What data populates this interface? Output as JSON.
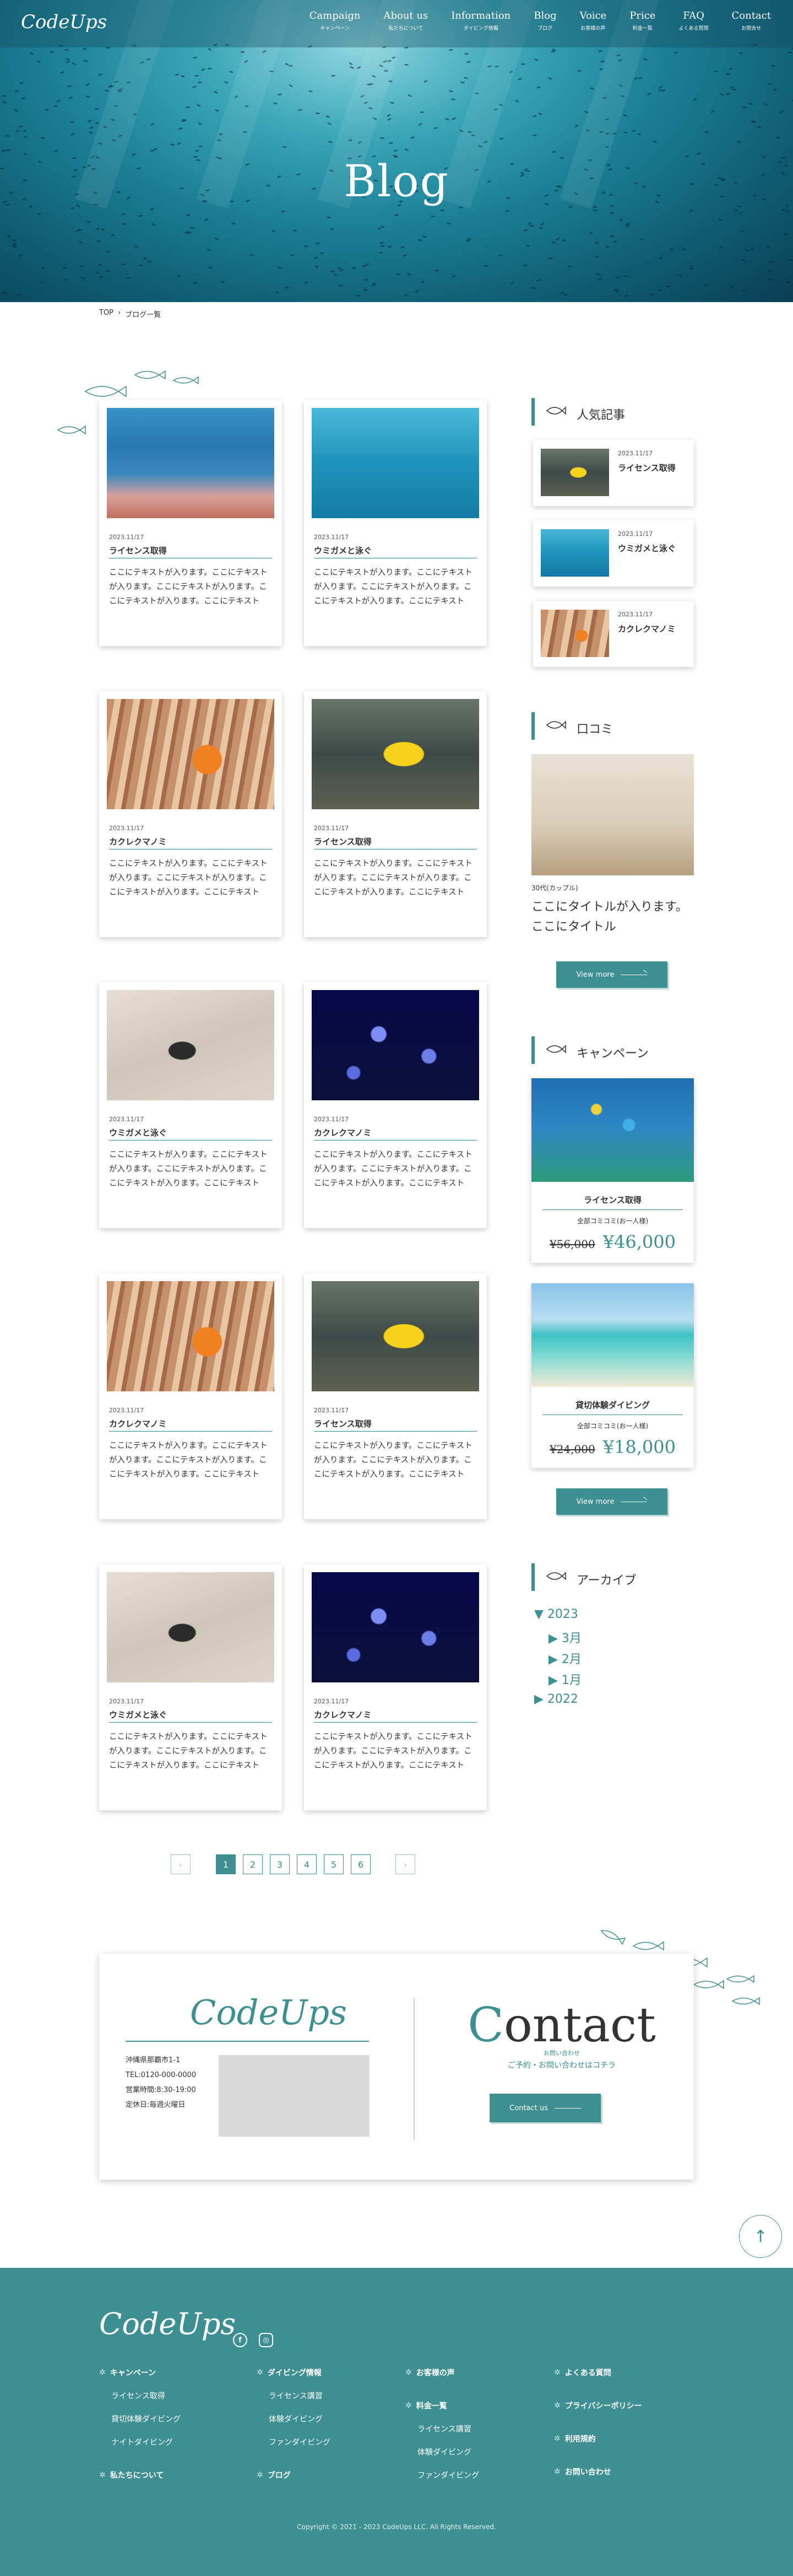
{
  "header": {
    "logo": "CodeUps",
    "nav": [
      {
        "en": "Campaign",
        "ja": "キャンペーン"
      },
      {
        "en": "About us",
        "ja": "私たちについて"
      },
      {
        "en": "Information",
        "ja": "ダイビング情報"
      },
      {
        "en": "Blog",
        "ja": "ブログ"
      },
      {
        "en": "Voice",
        "ja": "お客様の声"
      },
      {
        "en": "Price",
        "ja": "料金一覧"
      },
      {
        "en": "FAQ",
        "ja": "よくある質問"
      },
      {
        "en": "Contact",
        "ja": "お問合せ"
      }
    ]
  },
  "hero": {
    "title": "Blog"
  },
  "breadcrumb": {
    "home": "TOP",
    "sep": "›",
    "current": "ブログ一覧"
  },
  "blog": {
    "excerpt": "ここにテキストが入ります。ここにテキストが入ります。ここにテキストが入ります。ここにテキストが入ります。ここにテキスト",
    "cards": [
      {
        "date": "2023.11/17",
        "title": "ライセンス取得",
        "photo": "coral"
      },
      {
        "date": "2023.11/17",
        "title": "ウミガメと泳ぐ",
        "photo": "turtle"
      },
      {
        "date": "2023.11/17",
        "title": "カクレクマノミ",
        "photo": "clownfish"
      },
      {
        "date": "2023.11/17",
        "title": "ライセンス取得",
        "photo": "yellow-fish"
      },
      {
        "date": "2023.11/17",
        "title": "ウミガメと泳ぐ",
        "photo": "nudibranch"
      },
      {
        "date": "2023.11/17",
        "title": "カクレクマノミ",
        "photo": "jellyfish"
      },
      {
        "date": "2023.11/17",
        "title": "カクレクマノミ",
        "photo": "clownfish"
      },
      {
        "date": "2023.11/17",
        "title": "ライセンス取得",
        "photo": "yellow-fish"
      },
      {
        "date": "2023.11/17",
        "title": "ウミガメと泳ぐ",
        "photo": "nudibranch"
      },
      {
        "date": "2023.11/17",
        "title": "カクレクマノミ",
        "photo": "jellyfish"
      }
    ]
  },
  "pagination": {
    "prev": "‹",
    "next": "›",
    "pages": [
      "1",
      "2",
      "3",
      "4",
      "5",
      "6"
    ],
    "current": "1"
  },
  "sidebar": {
    "popular": {
      "heading": "人気記事",
      "items": [
        {
          "date": "2023.11/17",
          "title": "ライセンス取得"
        },
        {
          "date": "2023.11/17",
          "title": "ウミガメと泳ぐ"
        },
        {
          "date": "2023.11/17",
          "title": "カクレクマノミ"
        }
      ]
    },
    "review": {
      "heading": "口コミ",
      "meta": "30代(カップル)",
      "title": "ここにタイトルが入ります。ここにタイトル",
      "button": "View more"
    },
    "campaign": {
      "heading": "キャンペーン",
      "items": [
        {
          "title": "ライセンス取得",
          "sub": "全部コミコミ(お一人様)",
          "old": "¥56,000",
          "new": "¥46,000"
        },
        {
          "title": "貸切体験ダイビング",
          "sub": "全部コミコミ(お一人様)",
          "old": "¥24,000",
          "new": "¥18,000"
        }
      ],
      "button": "View more"
    },
    "archive": {
      "heading": "アーカイブ",
      "year_open": "▼ 2023",
      "months": [
        "▶ 3月",
        "▶ 2月",
        "▶ 1月"
      ],
      "year_closed": "▶ 2022"
    }
  },
  "contact": {
    "logo": "CodeUps",
    "address": [
      "沖縄県那覇市1-1",
      "TEL:0120-000-0000",
      "営業時間:8:30-19:00",
      "定休日:毎週火曜日"
    ],
    "title_first": "C",
    "title_rest": "ontact",
    "sub_ja": "お問い合わせ",
    "lead": "ご予約・お問い合わせはコチラ",
    "button": "Contact us"
  },
  "to_top": "↑",
  "footer": {
    "logo": "CodeUps",
    "sns": [
      "f",
      "◎"
    ],
    "col1": {
      "head": "キャンペーン",
      "items": [
        "ライセンス取得",
        "貸切体験ダイビング",
        "ナイトダイビング"
      ],
      "head2": "私たちについて"
    },
    "col2": {
      "head": "ダイビング情報",
      "items": [
        "ライセンス講習",
        "体験ダイビング",
        "ファンダイビング"
      ],
      "head2": "ブログ"
    },
    "col3": {
      "head": "お客様の声",
      "head2": "料金一覧",
      "items": [
        "ライセンス講習",
        "体験ダイビング",
        "ファンダイビング"
      ]
    },
    "col4": {
      "heads": [
        "よくある質問",
        "プライバシーポリシー",
        "利用規約",
        "お問い合わせ"
      ]
    },
    "copyright": "Copyright © 2021 - 2023 CodeUps LLC. All Rights Reserved."
  },
  "colors": {
    "accent": "#3e8f92",
    "footer_bg": "#3e8f92"
  }
}
